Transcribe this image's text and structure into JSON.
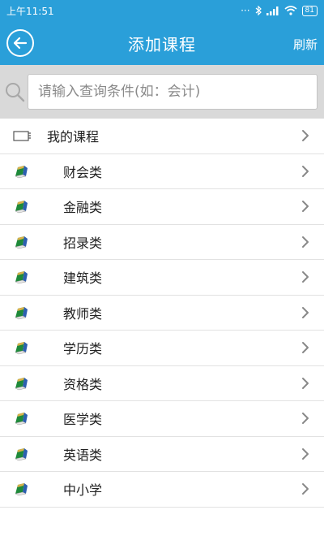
{
  "status_bar": {
    "time": "上午11:51",
    "battery": "81"
  },
  "header": {
    "title": "添加课程",
    "refresh_label": "刷新"
  },
  "search": {
    "placeholder": "请输入查询条件(如：会计)"
  },
  "list": {
    "my_courses": "我的课程",
    "categories": [
      "财会类",
      "金融类",
      "招录类",
      "建筑类",
      "教师类",
      "学历类",
      "资格类",
      "医学类",
      "英语类",
      "中小学"
    ]
  },
  "colors": {
    "header_bg": "#2a9fd9",
    "search_bg": "#d9d9d9",
    "divider": "#e2e2e2"
  }
}
